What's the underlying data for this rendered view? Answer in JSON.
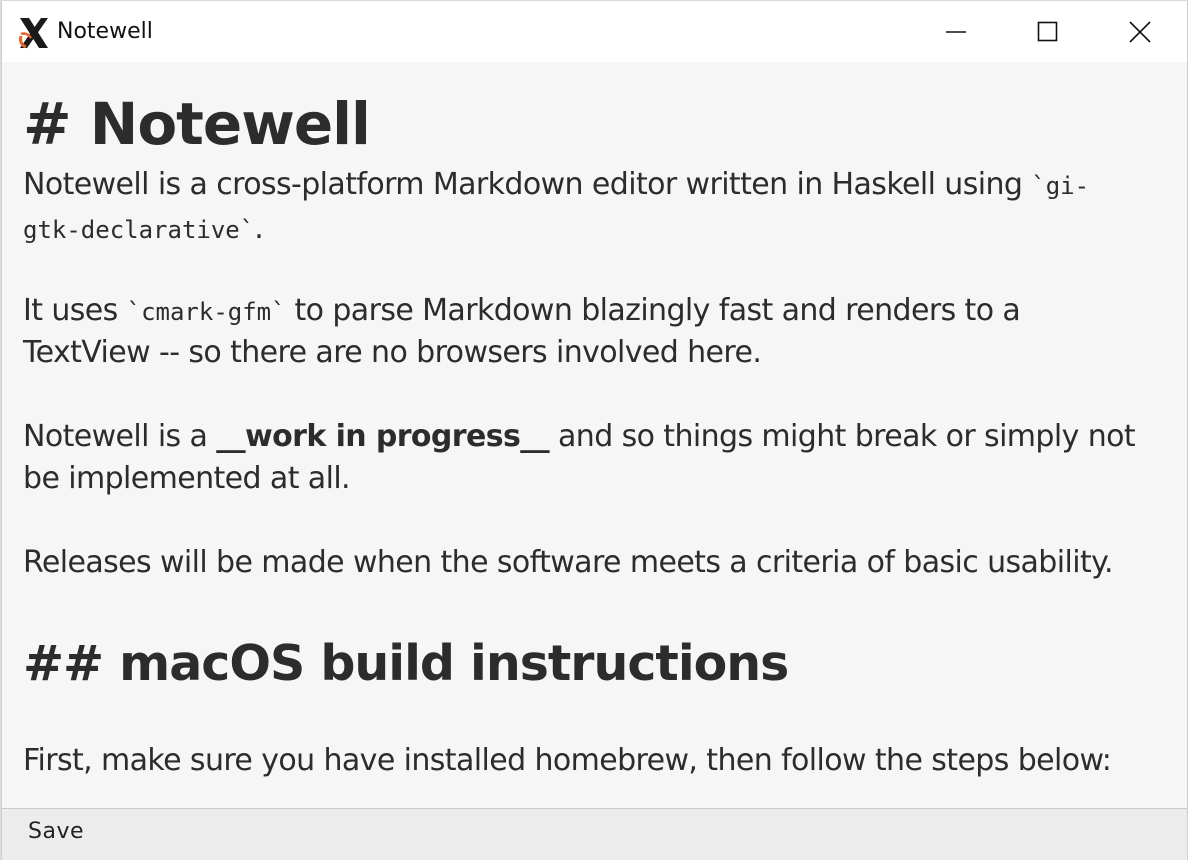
{
  "window": {
    "title": "Notewell",
    "icon": "x-logo-icon"
  },
  "controls": {
    "minimize_icon": "minimize-icon",
    "maximize_icon": "maximize-icon",
    "close_icon": "close-icon"
  },
  "document": {
    "h1": "# Notewell",
    "p1_line1_a": "Notewell is a cross-platform Markdown editor written in Haskell using ",
    "p1_line1_code": "`gi-",
    "p1_line2_code": "gtk-declarative`",
    "p1_line2_b": ".",
    "p2_line1_a": "It uses ",
    "p2_line1_code": "`cmark-gfm`",
    "p2_line1_b": " to parse Markdown blazingly fast and renders to a",
    "p2_line2": "TextView -- so there are no browsers involved here.",
    "p3_line1_a": "Notewell is a ",
    "p3_line1_bold": "__work in progress__",
    "p3_line1_b": " and so things might break or simply not",
    "p3_line2": "be implemented at all.",
    "p4_line1": "Releases will be made when the software meets a criteria of basic usability.",
    "h2": "## macOS build instructions",
    "p5_line1": "First, make sure you have installed homebrew, then follow the steps below:"
  },
  "statusbar": {
    "save_label": "Save"
  }
}
